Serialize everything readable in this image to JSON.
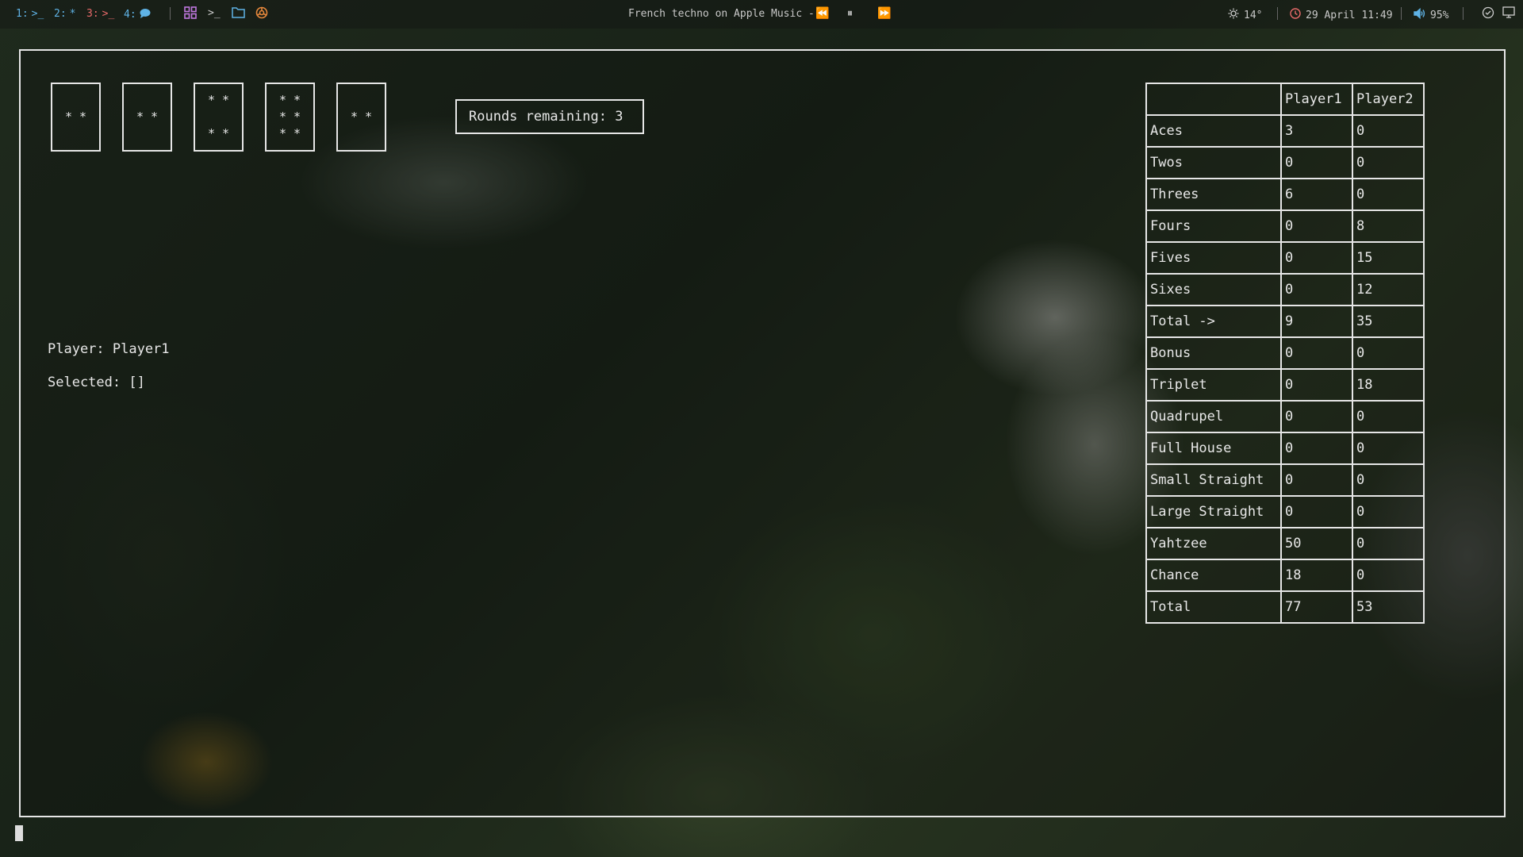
{
  "topbar": {
    "workspaces": [
      {
        "num": "1:",
        "glyph": ">_",
        "color": "blue"
      },
      {
        "num": "2:",
        "glyph": "*",
        "color": "blue"
      },
      {
        "num": "3:",
        "glyph": ">_",
        "color": "red"
      },
      {
        "num": "4:",
        "glyph": "chat-icon",
        "color": "blue"
      }
    ],
    "now_playing": "French techno on Apple Music -",
    "media": {
      "prev": "⏪",
      "pause": "⏸",
      "next": "⏩"
    },
    "weather": "14°",
    "datetime": "29 April 11:49",
    "volume": "95%"
  },
  "game": {
    "dice": [
      {
        "face": "* *"
      },
      {
        "face": "* *"
      },
      {
        "face": "* *\n\n* *"
      },
      {
        "face": "* *\n* *\n* *"
      },
      {
        "face": "* *"
      }
    ],
    "rounds_remaining": "Rounds remaining: 3",
    "player": "Player: Player1",
    "selected": "Selected: []"
  },
  "scoreboard": {
    "headers": [
      "",
      "Player1",
      "Player2"
    ],
    "rows": [
      [
        "Aces",
        "3",
        "0"
      ],
      [
        "Twos",
        "0",
        "0"
      ],
      [
        "Threes",
        "6",
        "0"
      ],
      [
        "Fours",
        "0",
        "8"
      ],
      [
        "Fives",
        "0",
        "15"
      ],
      [
        "Sixes",
        "0",
        "12"
      ],
      [
        "Total ->",
        "9",
        "35"
      ],
      [
        "Bonus",
        "0",
        "0"
      ],
      [
        "Triplet",
        "0",
        "18"
      ],
      [
        "Quadrupel",
        "0",
        "0"
      ],
      [
        "Full House",
        "0",
        "0"
      ],
      [
        "Small Straight",
        "0",
        "0"
      ],
      [
        "Large Straight",
        "0",
        "0"
      ],
      [
        "Yahtzee",
        "50",
        "0"
      ],
      [
        "Chance",
        "18",
        "0"
      ],
      [
        "Total",
        "77",
        "53"
      ]
    ]
  }
}
